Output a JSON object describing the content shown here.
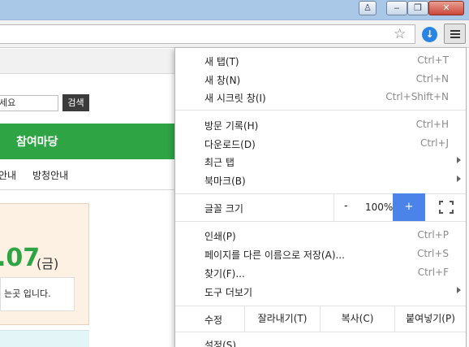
{
  "window": {
    "user_icon": "user-icon",
    "minimize_icon": "minimize-icon",
    "maximize_icon": "maximize-icon",
    "close_icon": "close-icon"
  },
  "toolbar": {
    "star_glyph": "☆",
    "download_glyph": "↓"
  },
  "page": {
    "search_value": "세요",
    "search_button": "검색",
    "green_bar_title": "참여마당",
    "nav_items": [
      "안내",
      "방청안내"
    ],
    "date_number": ".07",
    "date_day": "(금)",
    "info_message": "는곳 입니다.",
    "accent_color": "#2ea445"
  },
  "menu": {
    "section1": [
      {
        "label": "새 탭(T)",
        "shortcut": "Ctrl+T"
      },
      {
        "label": "새 창(N)",
        "shortcut": "Ctrl+N"
      },
      {
        "label": "새 시크릿 창(I)",
        "shortcut": "Ctrl+Shift+N"
      }
    ],
    "section2": [
      {
        "label": "방문 기록(H)",
        "shortcut": "Ctrl+H"
      },
      {
        "label": "다운로드(D)",
        "shortcut": "Ctrl+J"
      },
      {
        "label": "최근 탭",
        "shortcut": ""
      },
      {
        "label": "북마크(B)",
        "shortcut": ""
      }
    ],
    "zoom": {
      "label": "글꼴 크기",
      "minus": "-",
      "value": "100%",
      "plus": "+",
      "plus_color": "#4a84e8"
    },
    "section4": [
      {
        "label": "인쇄(P)",
        "shortcut": "Ctrl+P"
      },
      {
        "label": "페이지를 다른 이름으로 저장(A)...",
        "shortcut": "Ctrl+S"
      },
      {
        "label": "찾기(F)...",
        "shortcut": "Ctrl+F"
      },
      {
        "label": "도구 더보기",
        "shortcut": ""
      }
    ],
    "edit": {
      "label": "수정",
      "cut": "잘라내기(T)",
      "copy": "복사(C)",
      "paste": "붙여넣기(P)"
    },
    "settings": "설정(S)"
  }
}
